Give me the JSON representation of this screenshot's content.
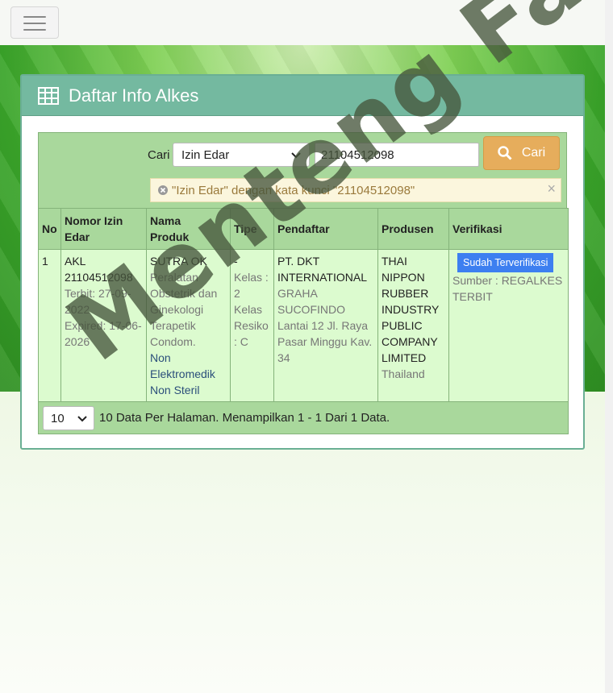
{
  "panel": {
    "title": "Daftar Info Alkes",
    "icon": "table-icon"
  },
  "search": {
    "label": "Cari",
    "category_selected": "Izin Edar",
    "query_value": "21104512098",
    "button_label": "Cari",
    "filter_notice": "\"Izin Edar\" dengan kata kunci \"21104512098\""
  },
  "table": {
    "headers": {
      "no": "No",
      "nomor_izin_line1": "Nomor Izin",
      "nomor_izin_line2": "Edar",
      "nama_line1": "Nama",
      "nama_line2": "Produk",
      "tipe": "Tipe",
      "pendaftar": "Pendaftar",
      "produsen": "Produsen",
      "verifikasi": "Verifikasi"
    },
    "rows": [
      {
        "no": "1",
        "akl": "AKL",
        "izin_number": "21104512098",
        "terbit": "Terbit: 27-09-2022",
        "expired": "Expired: 17-06-2026",
        "product_name": "SUTRA OK",
        "product_category": "Peralatan Obstetrik dan Ginekologi Terapetik Condom.",
        "product_type": "Non Elektromedik Non Steril",
        "tipe_dash": "-",
        "tipe_kelas": "Kelas : 2",
        "tipe_resiko": "Kelas Resiko : C",
        "pendaftar_name": "PT. DKT INTERNATIONAL",
        "pendaftar_address": "GRAHA SUCOFINDO Lantai 12 Jl. Raya Pasar Minggu Kav. 34",
        "produsen_name": "THAI NIPPON RUBBER INDUSTRY PUBLIC COMPANY LIMITED",
        "produsen_country": "Thailand",
        "verif_badge": "Sudah Terverifikasi",
        "verif_source": "Sumber : REGALKES TERBIT"
      }
    ]
  },
  "pager": {
    "page_size": "10",
    "summary": "10 Data Per Halaman. Menampilkan 1 - 1 Dari 1 Data."
  },
  "watermark": "Menteng Farma",
  "colors": {
    "header_green": "#74b9a0",
    "table_green": "#a9d89c",
    "row_green": "#dcfbcf",
    "cari_orange": "#e6ad5c",
    "badge_blue": "#3d7ff0"
  }
}
